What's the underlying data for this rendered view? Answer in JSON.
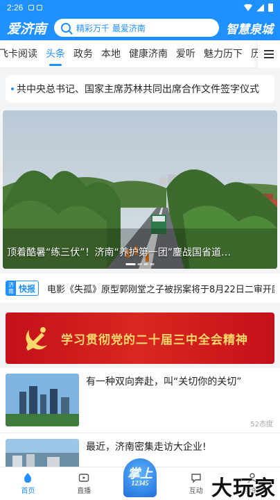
{
  "status_bar": {
    "time": "2:26"
  },
  "header": {
    "logo_left": "爱济南",
    "search_placeholder": "精彩万千  最爱济南",
    "logo_right": "智慧泉城"
  },
  "tabs": [
    {
      "label": "飞卡阅读",
      "active": false
    },
    {
      "label": "头条",
      "active": true
    },
    {
      "label": "政务",
      "active": false
    },
    {
      "label": "本地",
      "active": false
    },
    {
      "label": "健康济南",
      "active": false
    },
    {
      "label": "爱听",
      "active": false
    },
    {
      "label": "魅力历下",
      "active": false
    },
    {
      "label": "历",
      "active": false
    }
  ],
  "headline": {
    "text": "共中央总书记、国家主席苏林共同出席合作文件签字仪式"
  },
  "banner": {
    "caption": "顶着酷暑“练三伏”！济南“养护第一团”鏖战国省道…"
  },
  "flash": {
    "badge_small": "济南",
    "badge_label": "快报",
    "text": "电影《失孤》原型郭刚堂之子被拐案将于8月22日二审开庭"
  },
  "promo": {
    "text": "学习贯彻党的二十届三中全会精神"
  },
  "news": [
    {
      "title": "有一种双向奔赴，叫“关切你的关切”",
      "meta": "52态度"
    },
    {
      "title": "最近，济南密集走访大企业!",
      "meta": ""
    }
  ],
  "bottom_nav": [
    {
      "label": "首页",
      "icon": "home-icon",
      "active": true
    },
    {
      "label": "直播",
      "icon": "live-icon",
      "active": false
    },
    {
      "label": "",
      "icon": "hotline-12345-icon",
      "active": false
    },
    {
      "label": "互动",
      "icon": "chat-icon",
      "active": false
    },
    {
      "label": "我的",
      "icon": "user-icon",
      "active": false
    }
  ],
  "center_badge": {
    "line1": "掌上",
    "line2": "12345"
  },
  "watermark": "大玩家",
  "colors": {
    "brand": "#1e90ff",
    "promo_red": "#c4101a",
    "promo_gold": "#ffd76a"
  }
}
